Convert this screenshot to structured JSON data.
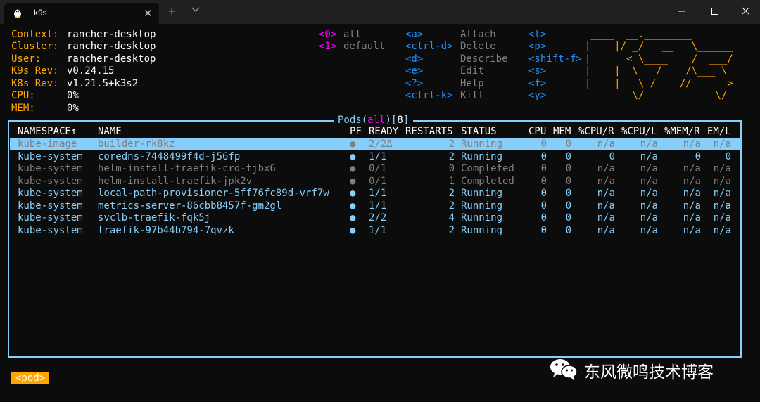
{
  "window": {
    "tab_title": "k9s",
    "tab_close_glyph": "✕",
    "new_tab_glyph": "+"
  },
  "info": [
    {
      "label": "Context:",
      "value": "rancher-desktop"
    },
    {
      "label": "Cluster:",
      "value": "rancher-desktop"
    },
    {
      "label": "User:",
      "value": "rancher-desktop"
    },
    {
      "label": "K9s Rev:",
      "value": "v0.24.15"
    },
    {
      "label": "K8s Rev:",
      "value": "v1.21.5+k3s2"
    },
    {
      "label": "CPU:",
      "value": "0%"
    },
    {
      "label": "MEM:",
      "value": "0%"
    }
  ],
  "namespaces": [
    {
      "key": "<0>",
      "name": "all"
    },
    {
      "key": "<1>",
      "name": "default"
    }
  ],
  "shortcuts_left": [
    {
      "key": "<a>",
      "action": "Attach"
    },
    {
      "key": "<ctrl-d>",
      "action": "Delete"
    },
    {
      "key": "<d>",
      "action": "Describe"
    },
    {
      "key": "<e>",
      "action": "Edit"
    },
    {
      "key": "<?>",
      "action": "Help"
    },
    {
      "key": "<ctrl-k>",
      "action": "Kill"
    }
  ],
  "shortcuts_right": [
    "<l>",
    "<p>",
    "<shift-f>",
    "<s>",
    "<f>",
    "<y>"
  ],
  "logo_lines": [
    " ____  __.________       ",
    "|    |/ _/   __   \\______",
    "|      < \\____    /  ___/",
    "|    |  \\   /    /\\___ \\ ",
    "|____|__ \\ /____//____  >",
    "        \\/            \\/ "
  ],
  "table": {
    "title_prefix": "Pods(",
    "title_ns": "all",
    "title_mid": ")[",
    "title_count": "8",
    "title_suffix": "]",
    "columns": [
      "NAMESPACE↑",
      "NAME",
      "PF",
      "READY",
      "RESTARTS",
      "STATUS",
      "CPU",
      "MEM",
      "%CPU/R",
      "%CPU/L",
      "%MEM/R",
      "EM/L"
    ],
    "rows": [
      {
        "ns": "kube-image",
        "name": "builder-rk8kz",
        "pf": "●",
        "ready": "2/2Δ",
        "restarts": "2",
        "status": "Running",
        "cpu": "0",
        "mem": "0",
        "cpur": "n/a",
        "cpul": "n/a",
        "memr": "n/a",
        "meml": "n/a",
        "style": "selected"
      },
      {
        "ns": "kube-system",
        "name": "coredns-7448499f4d-j56fp",
        "pf": "●",
        "ready": "1/1",
        "restarts": "2",
        "status": "Running",
        "cpu": "0",
        "mem": "0",
        "cpur": "0",
        "cpul": "n/a",
        "memr": "0",
        "meml": "0",
        "style": "running"
      },
      {
        "ns": "kube-system",
        "name": "helm-install-traefik-crd-tjbx6",
        "pf": "●",
        "ready": "0/1",
        "restarts": "0",
        "status": "Completed",
        "cpu": "0",
        "mem": "0",
        "cpur": "n/a",
        "cpul": "n/a",
        "memr": "n/a",
        "meml": "n/a",
        "style": "completed"
      },
      {
        "ns": "kube-system",
        "name": "helm-install-traefik-jpk2v",
        "pf": "●",
        "ready": "0/1",
        "restarts": "1",
        "status": "Completed",
        "cpu": "0",
        "mem": "0",
        "cpur": "n/a",
        "cpul": "n/a",
        "memr": "n/a",
        "meml": "n/a",
        "style": "completed"
      },
      {
        "ns": "kube-system",
        "name": "local-path-provisioner-5ff76fc89d-vrf7w",
        "pf": "●",
        "ready": "1/1",
        "restarts": "2",
        "status": "Running",
        "cpu": "0",
        "mem": "0",
        "cpur": "n/a",
        "cpul": "n/a",
        "memr": "n/a",
        "meml": "n/a",
        "style": "running"
      },
      {
        "ns": "kube-system",
        "name": "metrics-server-86cbb8457f-gm2gl",
        "pf": "●",
        "ready": "1/1",
        "restarts": "2",
        "status": "Running",
        "cpu": "0",
        "mem": "0",
        "cpur": "n/a",
        "cpul": "n/a",
        "memr": "n/a",
        "meml": "n/a",
        "style": "running"
      },
      {
        "ns": "kube-system",
        "name": "svclb-traefik-fqk5j",
        "pf": "●",
        "ready": "2/2",
        "restarts": "4",
        "status": "Running",
        "cpu": "0",
        "mem": "0",
        "cpur": "n/a",
        "cpul": "n/a",
        "memr": "n/a",
        "meml": "n/a",
        "style": "running"
      },
      {
        "ns": "kube-system",
        "name": "traefik-97b44b794-7qvzk",
        "pf": "●",
        "ready": "1/1",
        "restarts": "2",
        "status": "Running",
        "cpu": "0",
        "mem": "0",
        "cpur": "n/a",
        "cpul": "n/a",
        "memr": "n/a",
        "meml": "n/a",
        "style": "running"
      }
    ]
  },
  "footer": {
    "crumb": "<pod>"
  },
  "watermark": {
    "text": "东风微鸣技术博客",
    "icon": "wechat-icon"
  },
  "colors": {
    "background": "#0c0c0c",
    "label": "#ffa500",
    "key": "#1e90ff",
    "namespace_key": "#ff00ff",
    "frame": "#87cefa",
    "selected_bg": "#87cefa",
    "running": "#87cefa",
    "completed": "#808080",
    "selected_text": "#808080",
    "crumb_bg": "#ffa500"
  }
}
